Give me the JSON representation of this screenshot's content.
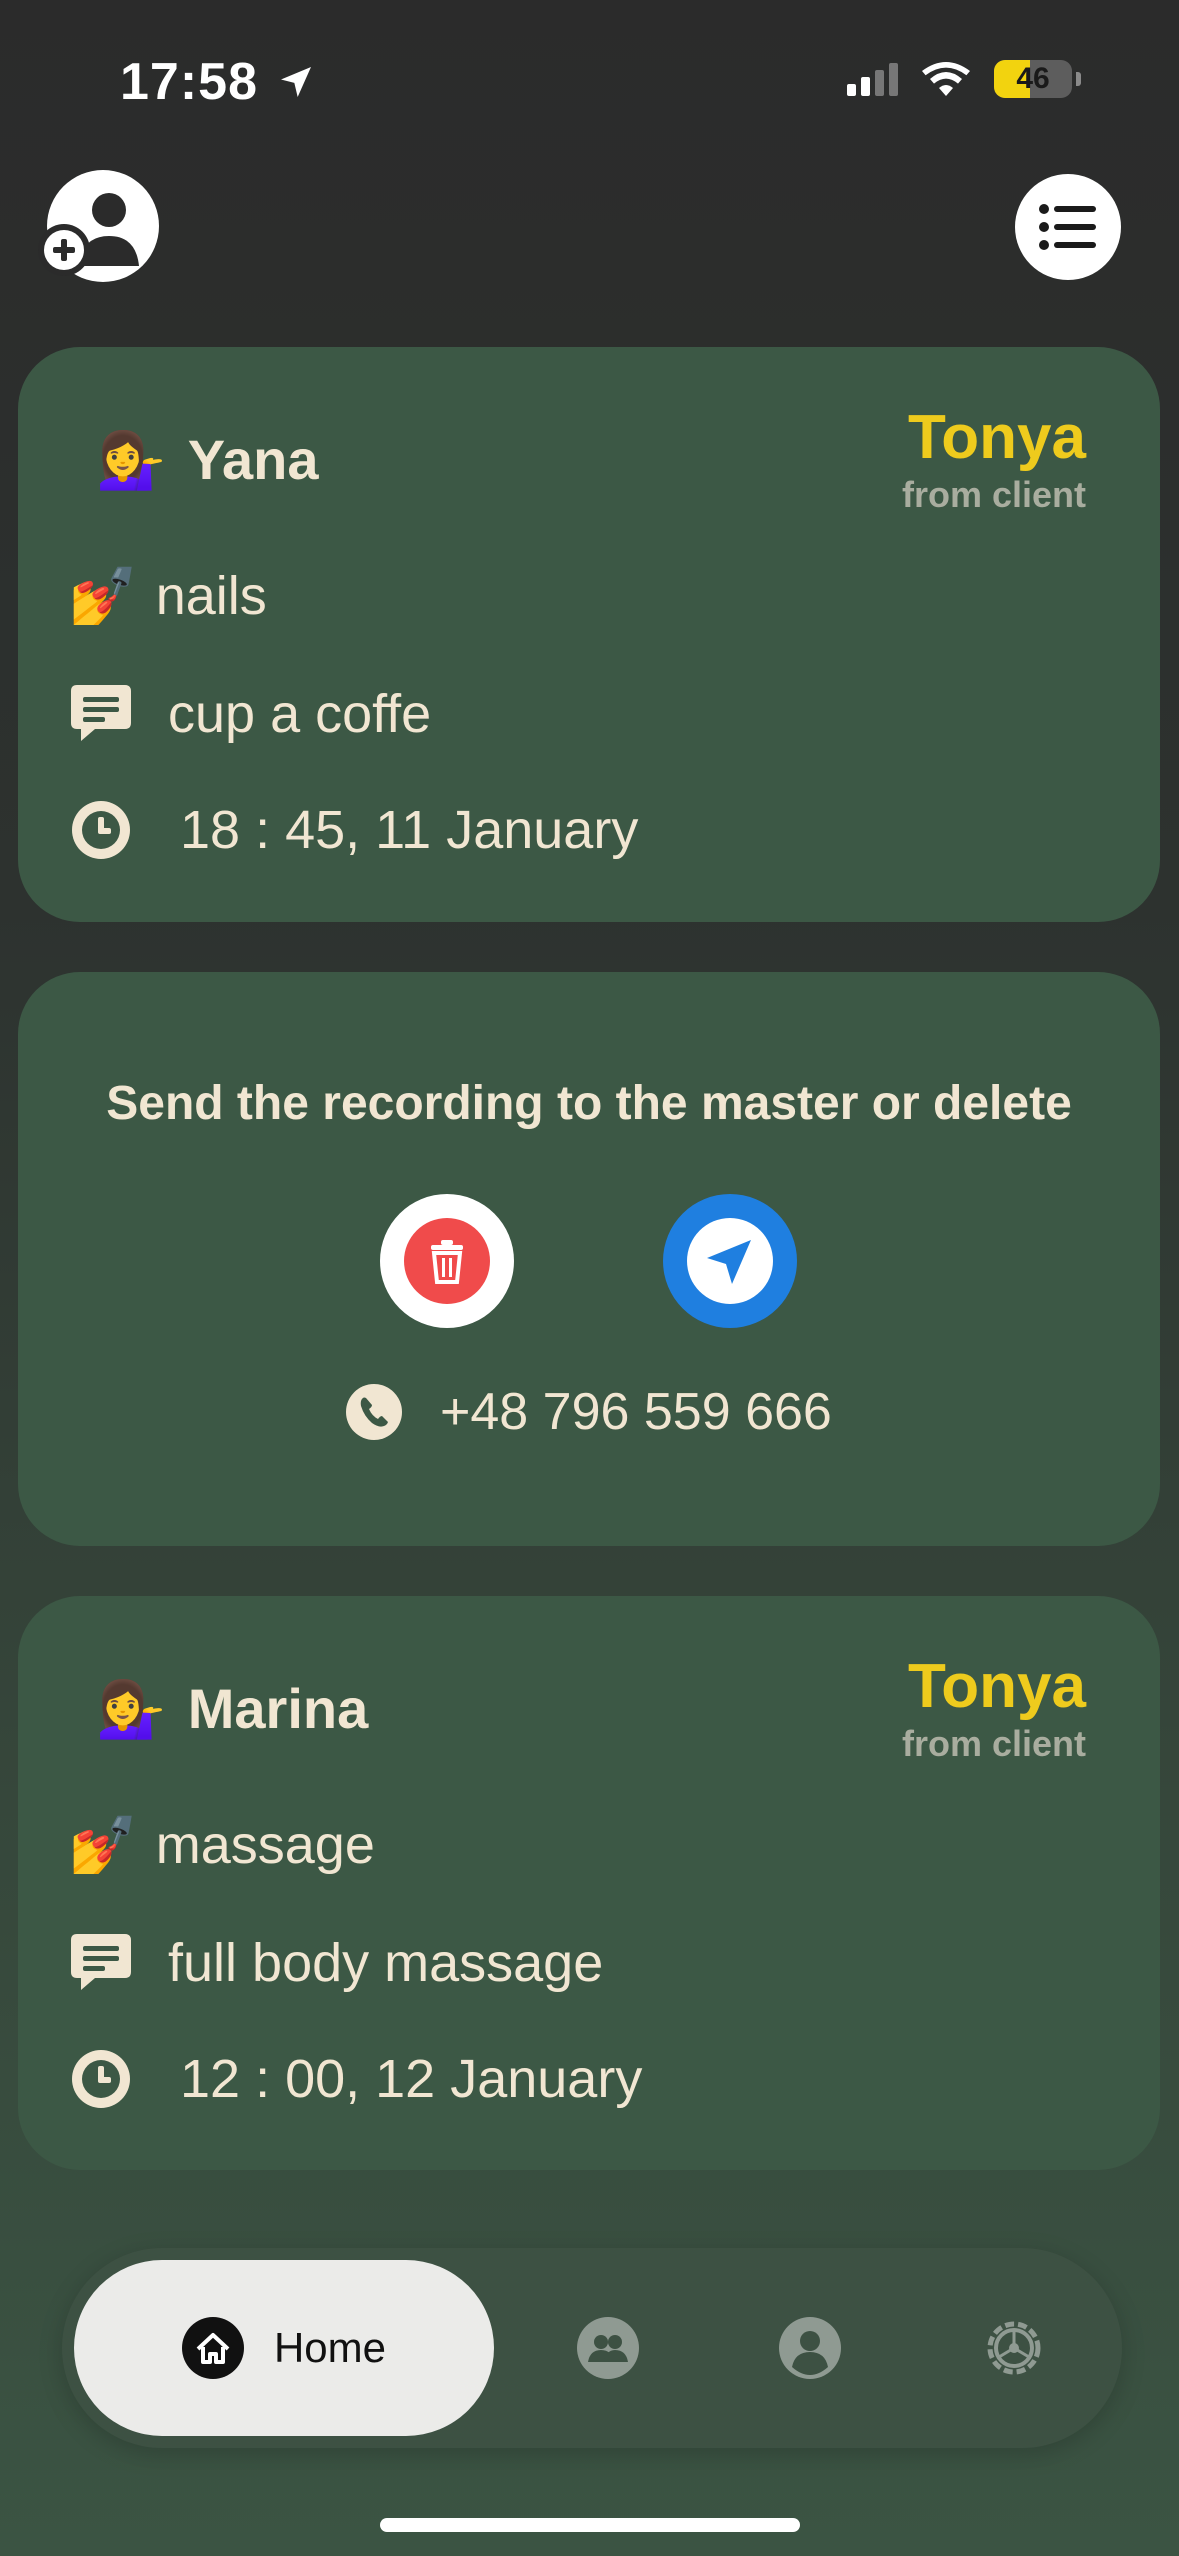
{
  "status_bar": {
    "time": "17:58",
    "battery": "46",
    "icons": [
      "location-arrow-icon",
      "signal-icon",
      "wifi-icon",
      "battery-icon"
    ]
  },
  "header": {
    "add_client_icon": "add-user-icon",
    "menu_icon": "list-icon"
  },
  "records": [
    {
      "client_emoji": "💁‍♀️",
      "client": "Yana",
      "master": "Tonya",
      "source": "from client",
      "service_emoji": "💅",
      "service": "nails",
      "comment": "cup a coffe",
      "time": "18 : 45,  11 January"
    },
    {
      "client_emoji": "💁‍♀️",
      "client": "Marina",
      "master": "Tonya",
      "source": "from client",
      "service_emoji": "💅",
      "service": "massage",
      "comment": "full body massage",
      "time": "12 : 00,  12 January"
    }
  ],
  "pending": {
    "headline": "Send the recording to the master or delete",
    "phone": "+48 796 559 666"
  },
  "tabbar": {
    "home_label": "Home",
    "tabs": [
      "home-icon",
      "clients-icon",
      "profile-icon",
      "settings-icon"
    ]
  },
  "colors": {
    "card": "#3c5845",
    "master": "#eecb1d",
    "text": "#f1e6d2",
    "delete": "#f04b4b",
    "send": "#1f7fe0"
  }
}
